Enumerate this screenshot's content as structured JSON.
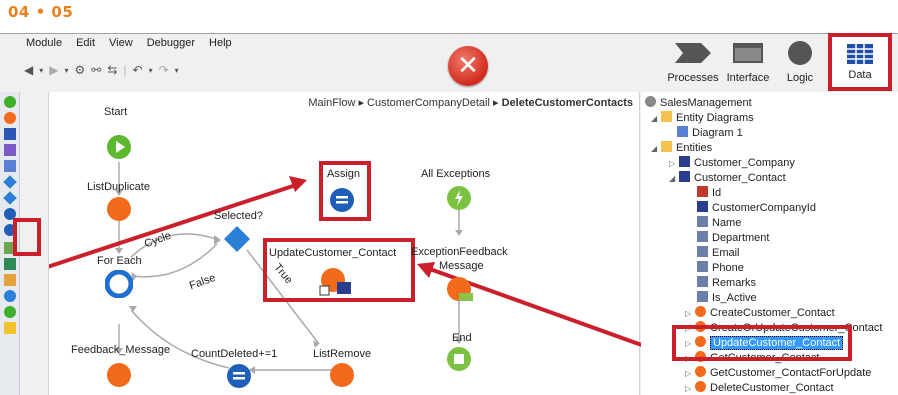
{
  "page_label": "04 • 05",
  "menu": [
    "Module",
    "Edit",
    "View",
    "Debugger",
    "Help"
  ],
  "toolbar_icons": [
    "back-icon",
    "forward-icon",
    "settings-icon",
    "compare-icon",
    "merge-icon",
    "undo-icon",
    "redo-icon"
  ],
  "tabs": {
    "processes": "Processes",
    "interface": "Interface",
    "logic": "Logic",
    "data": "Data"
  },
  "breadcrumb": {
    "path": "MainFlow ▸ CustomerCompanyDetail ▸ ",
    "current": "DeleteCustomerContacts"
  },
  "flow_nodes": {
    "start": "Start",
    "list_duplicate": "ListDuplicate",
    "for_each": "For Each",
    "feedback_message": "Feedback_Message",
    "selected": "Selected?",
    "cycle": "Cycle",
    "false_label": "False",
    "true_label": "True",
    "assign": "Assign",
    "update_customer_contact": "UpdateCustomer_Contact",
    "count_deleted": "CountDeleted+=1",
    "list_remove": "ListRemove",
    "all_exceptions": "All Exceptions",
    "exception_feedback_1": "ExceptionFeedback",
    "exception_feedback_2": "Message",
    "end": "End"
  },
  "tree": {
    "root": "SalesManagement",
    "entity_diagrams": "Entity Diagrams",
    "diagram_1": "Diagram 1",
    "entities": "Entities",
    "customer_company": "Customer_Company",
    "customer_contact": "Customer_Contact",
    "attributes": [
      "Id",
      "CustomerCompanyId",
      "Name",
      "Department",
      "Email",
      "Phone",
      "Remarks",
      "Is_Active"
    ],
    "actions": [
      "CreateCustomer_Contact",
      "CreateOrUpdateCustomer_Contact",
      "UpdateCustomer_Contact",
      "GetCustomer_Contact",
      "GetCustomer_ContactForUpdate",
      "DeleteCustomer_Contact"
    ]
  },
  "colors": {
    "highlight_red": "#cc1f2c",
    "page_label_orange": "#e8821e",
    "selection_blue": "#3399ff"
  }
}
